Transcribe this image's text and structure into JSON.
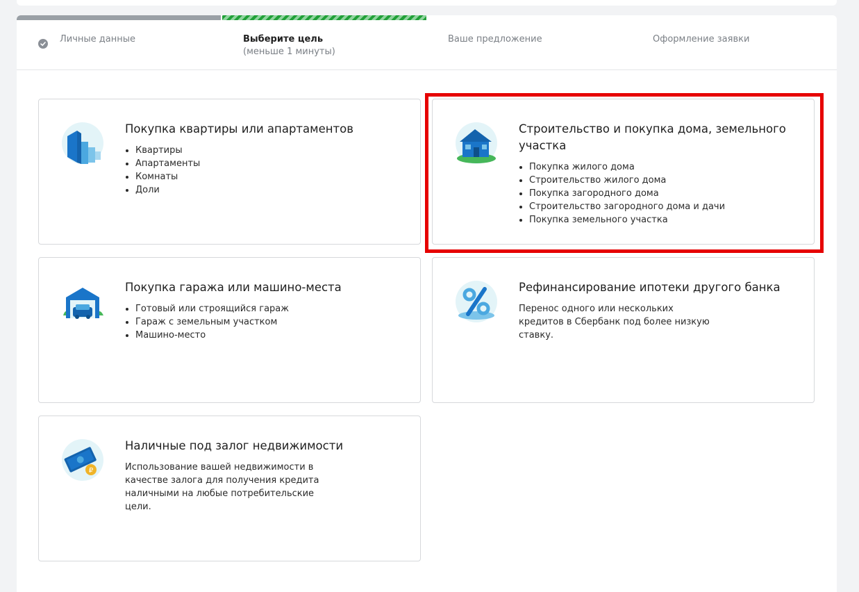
{
  "steps": [
    {
      "label": "Личные данные",
      "sub": ""
    },
    {
      "label": "Выберите цель",
      "sub": "(меньше 1 минуты)"
    },
    {
      "label": "Ваше предложение",
      "sub": ""
    },
    {
      "label": "Оформление заявки",
      "sub": ""
    }
  ],
  "progress": {
    "completed_steps": 1,
    "active_step": 2,
    "total_steps": 4
  },
  "cards": [
    {
      "title": "Покупка квартиры или апартаментов",
      "items": [
        "Квартиры",
        "Апартаменты",
        "Комнаты",
        "Доли"
      ],
      "icon": "apartment-buildings-icon"
    },
    {
      "title": "Строительство и покупка дома, земельного участка",
      "items": [
        "Покупка жилого дома",
        "Строительство жилого дома",
        "Покупка загородного дома",
        "Строительство загородного дома и дачи",
        "Покупка земельного участка"
      ],
      "icon": "house-icon"
    },
    {
      "title": "Покупка гаража или машино-места",
      "items": [
        "Готовый или строящийся гараж",
        "Гараж с земельным участком",
        "Машино-место"
      ],
      "icon": "garage-icon"
    },
    {
      "title": "Рефинансирование ипотеки другого банка",
      "description": "Перенос одного или нескольких кредитов в Сбербанк под более низкую ставку.",
      "icon": "percent-icon"
    },
    {
      "title": "Наличные под залог недвижимости",
      "description": "Использование вашей недвижимости в качестве залога для получения кредита наличными на любые потребительские цели.",
      "icon": "cash-icon"
    }
  ],
  "colors": {
    "accent": "#21a038",
    "highlight": "#e60000",
    "icon_bg": "#e3f4f8",
    "icon_blue": "#1a75c9"
  }
}
